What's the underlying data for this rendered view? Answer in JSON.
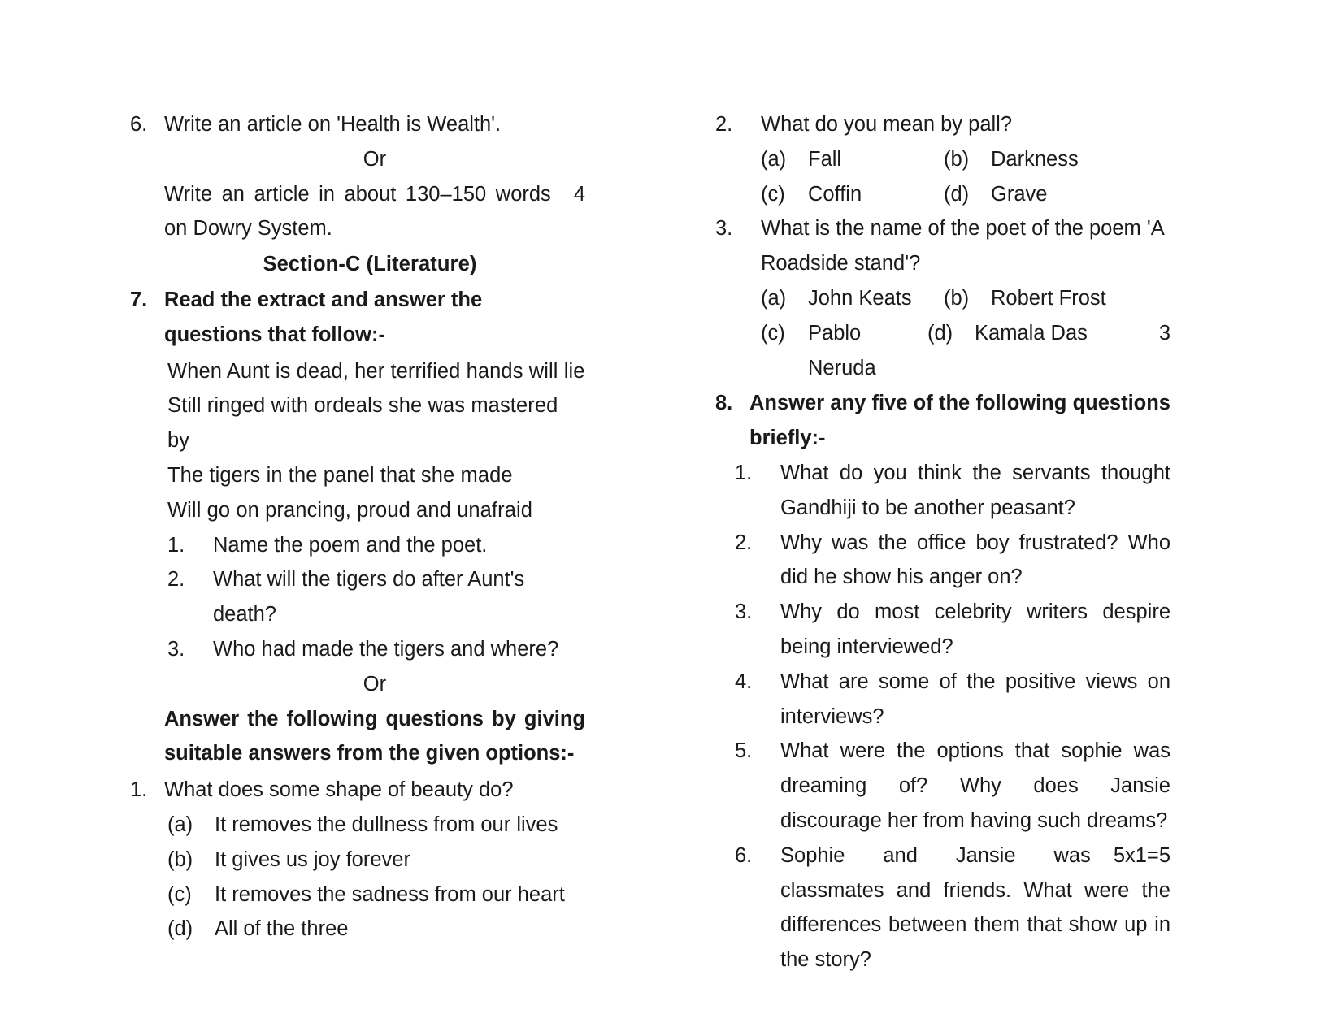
{
  "document": {
    "type": "question-paper-page",
    "columns": 2
  },
  "left_column": {
    "q6": {
      "number": "6.",
      "text": "Write an article on 'Health is Wealth'.",
      "or": "Or",
      "alt_text": "Write an article in about 130–150 words on Dowry System.",
      "marks": "4"
    },
    "section_heading": "Section-C (Literature)",
    "q7": {
      "number": "7.",
      "instruction": "Read the extract and answer the questions that follow:-",
      "extract_lines": [
        "When Aunt is dead, her terrified hands will lie",
        "Still ringed with ordeals she was mastered  by",
        "The tigers in the panel that she made",
        "Will go on prancing, proud and unafraid"
      ],
      "sub_questions": [
        {
          "number": "1.",
          "text": "Name the poem and the poet."
        },
        {
          "number": "2.",
          "text": "What will the tigers do after Aunt's death?"
        },
        {
          "number": "3.",
          "text": "Who had made the tigers and where?"
        }
      ],
      "or": "Or",
      "alt_instruction": "Answer the following questions by giving suitable  answers from the given options:-",
      "alt_question": {
        "number": "1.",
        "text": "What does some shape of beauty do?",
        "options": [
          {
            "label": "(a)",
            "text": "It removes the dullness from our lives"
          },
          {
            "label": "(b)",
            "text": "It gives us joy forever"
          },
          {
            "label": "(c)",
            "text": "It removes the sadness from our heart"
          },
          {
            "label": "(d)",
            "text": "All of the three"
          }
        ]
      }
    }
  },
  "right_column": {
    "mcq2": {
      "number": "2.",
      "text": "What do you mean by pall?",
      "options": [
        {
          "label": "(a)",
          "text": "Fall"
        },
        {
          "label": "(b)",
          "text": "Darkness"
        },
        {
          "label": "(c)",
          "text": "Coffin"
        },
        {
          "label": "(d)",
          "text": "Grave"
        }
      ]
    },
    "mcq3": {
      "number": "3.",
      "text": "What is the name of the poet of the poem 'A Roadside stand'?",
      "options": [
        {
          "label": "(a)",
          "text": "John Keats"
        },
        {
          "label": "(b)",
          "text": "Robert Frost"
        },
        {
          "label": "(c)",
          "text": "Pablo Neruda"
        },
        {
          "label": "(d)",
          "text": "Kamala Das"
        }
      ],
      "marks": "3"
    },
    "q8": {
      "number": "8.",
      "instruction": "Answer any five of the following questions briefly:-",
      "sub_questions": [
        {
          "number": "1.",
          "text": "What do you think the servants thought Gandhiji  to be another peasant?"
        },
        {
          "number": "2.",
          "text": "Why was the office boy frustrated? Who did he show his anger on?"
        },
        {
          "number": "3.",
          "text": "Why do most celebrity writers despire being interviewed?"
        },
        {
          "number": "4.",
          "text": "What are some of the positive views on interviews?"
        },
        {
          "number": "5.",
          "text": "What were the options that sophie was dreaming of? Why does Jansie discourage her from having such dreams?"
        },
        {
          "number": "6.",
          "text": "Sophie and Jansie was classmates and friends.  What were the differences between them that show up in the story?"
        }
      ],
      "marks": "5x1=5"
    }
  }
}
